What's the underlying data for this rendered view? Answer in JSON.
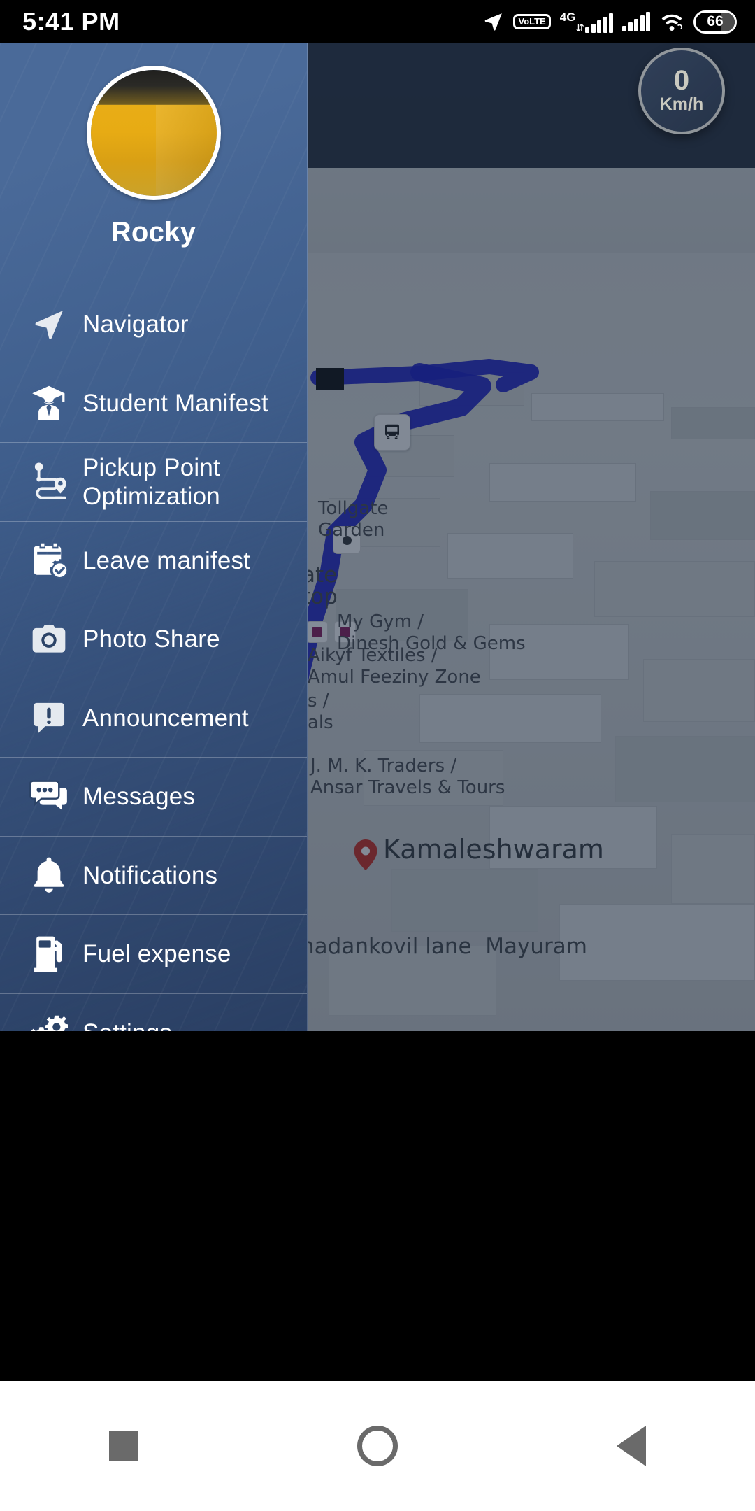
{
  "statusbar": {
    "time": "5:41 PM",
    "icons": [
      {
        "name": "location-icon",
        "label": "location"
      },
      {
        "name": "volte-icon",
        "line1": "Vo",
        "line2": "LTE"
      },
      {
        "name": "signal-4g-icon",
        "label": "4G"
      },
      {
        "name": "signal-2-icon",
        "label": "signal"
      },
      {
        "name": "wifi-icon",
        "label": "wifi"
      }
    ],
    "battery_percent": "66"
  },
  "drawer": {
    "user_name": "Rocky",
    "avatar_name": "user-avatar",
    "items": [
      {
        "id": "navigator",
        "label": "Navigator",
        "icon": "navigation-arrow-icon"
      },
      {
        "id": "student-manifest",
        "label": "Student Manifest",
        "icon": "graduate-student-icon"
      },
      {
        "id": "pickup-point",
        "label": "Pickup Point Optimization",
        "icon": "route-pin-icon"
      },
      {
        "id": "leave-manifest",
        "label": "Leave manifest",
        "icon": "calendar-check-icon"
      },
      {
        "id": "photo-share",
        "label": "Photo Share",
        "icon": "camera-icon"
      },
      {
        "id": "announcement",
        "label": "Announcement",
        "icon": "announcement-bubble-icon"
      },
      {
        "id": "messages",
        "label": "Messages",
        "icon": "chat-bubbles-icon"
      },
      {
        "id": "notifications",
        "label": "Notifications",
        "icon": "bell-icon"
      },
      {
        "id": "fuel-expense",
        "label": "Fuel expense",
        "icon": "fuel-pump-icon"
      },
      {
        "id": "settings",
        "label": "Settings",
        "icon": "gears-icon"
      }
    ]
  },
  "map": {
    "speedometer": {
      "value": "0",
      "unit": "Km/h"
    },
    "labels": [
      {
        "id": "tollgate-garden",
        "text": "Tollgate\nGarden"
      },
      {
        "id": "gate-stop",
        "text": "ate\ntop"
      },
      {
        "id": "my-gym",
        "text": "My Gym /\nDinesh Gold & Gems"
      },
      {
        "id": "aikyf-textiles",
        "text": "Aikyf Textiles /\nAmul Feeziny Zone"
      },
      {
        "id": "partial-label",
        "text": "s /\nals"
      },
      {
        "id": "jmk-traders",
        "text": "J. M. K. Traders /\nAnsar Travels & Tours"
      },
      {
        "id": "kamaleshwaram",
        "text": "Kamaleshwaram"
      },
      {
        "id": "road-name",
        "text": "nadankovil lane  Mayuram"
      }
    ],
    "colors": {
      "route": "#1e20c8",
      "pin": "#d93025",
      "shop_pin": "#8d1e5e"
    }
  },
  "navbar": {
    "recents_label": "Recents",
    "home_label": "Home",
    "back_label": "Back"
  }
}
